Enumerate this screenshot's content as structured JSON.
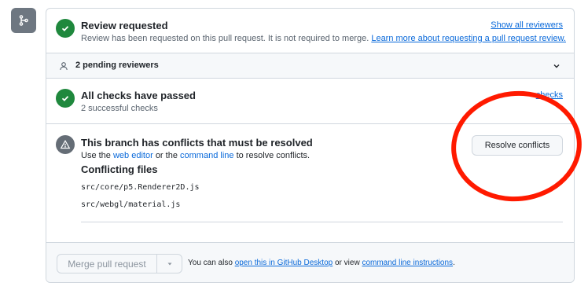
{
  "review": {
    "title": "Review requested",
    "description": "Review has been requested on this pull request. It is not required to merge.",
    "learn_more": "Learn more about requesting a pull request review.",
    "show_all": "Show all reviewers"
  },
  "pending": {
    "label": "2 pending reviewers"
  },
  "checks": {
    "title": "All checks have passed",
    "subtitle": "2 successful checks",
    "show_all_partial": "checks"
  },
  "conflicts": {
    "title": "This branch has conflicts that must be resolved",
    "use_the": "Use the",
    "web_editor": "web editor",
    "or_the": "or the",
    "command_line": "command line",
    "to_resolve": "to resolve conflicts.",
    "resolve_button": "Resolve conflicts",
    "files_heading": "Conflicting files",
    "files": [
      "src/core/p5.Renderer2D.js",
      "src/webgl/material.js"
    ]
  },
  "merge": {
    "button": "Merge pull request",
    "also_text": "You can also",
    "open_desktop": "open this in GitHub Desktop",
    "or_view": "or view",
    "cli_instructions": "command line instructions",
    "period": "."
  },
  "colors": {
    "success": "#1f883d",
    "link": "#0969da",
    "annotation": "#ff1a00"
  }
}
